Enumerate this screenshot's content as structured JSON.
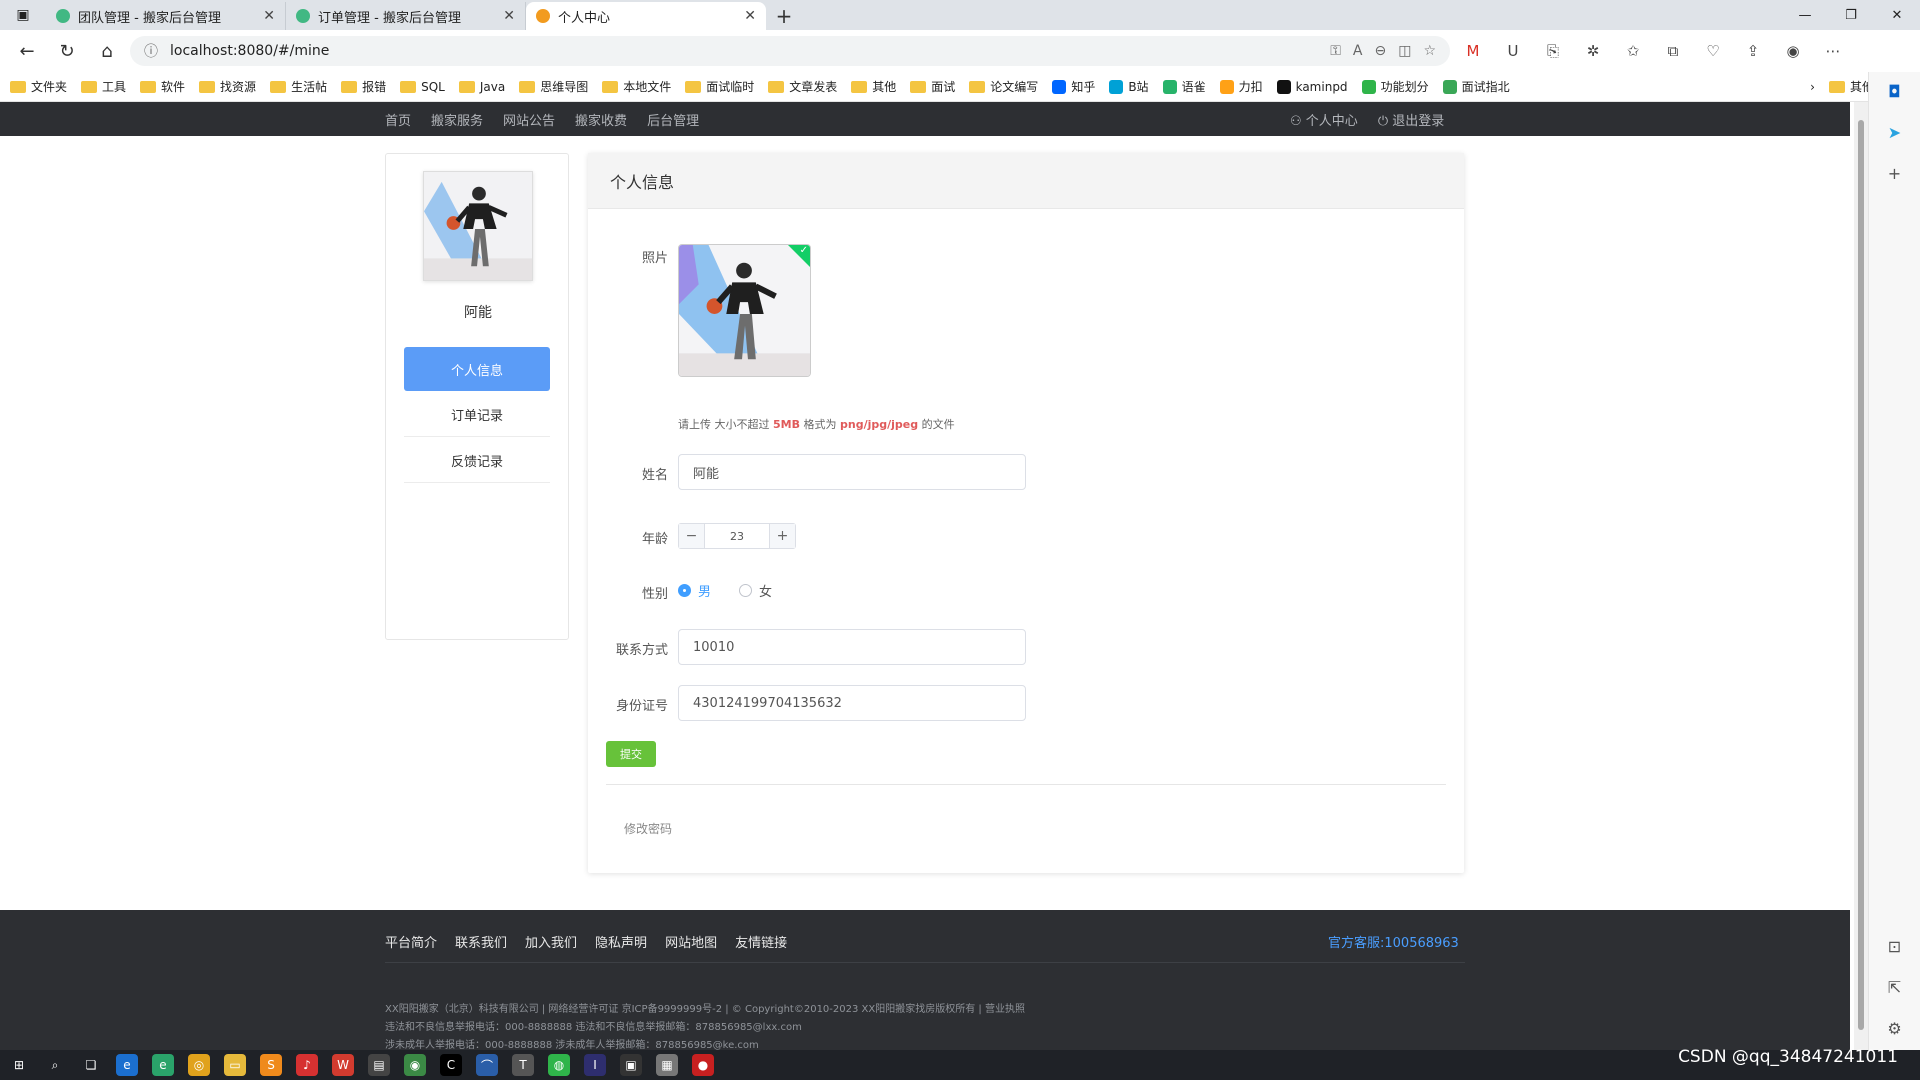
{
  "browser": {
    "tabs": [
      {
        "title": "团队管理 - 搬家后台管理",
        "favicon_color": "#41b883",
        "active": false
      },
      {
        "title": "订单管理 - 搬家后台管理",
        "favicon_color": "#41b883",
        "active": false
      },
      {
        "title": "个人中心",
        "favicon_color": "#f29b1f",
        "active": true
      }
    ],
    "url": "localhost:8080/#/mine",
    "bookmarks": [
      "文件夹",
      "工具",
      "软件",
      "找资源",
      "生活帖",
      "报错",
      "SQL",
      "Java",
      "思维导图",
      "本地文件",
      "面试临时",
      "文章发表",
      "其他",
      "面试",
      "论文编写",
      "知乎",
      "B站",
      "语雀",
      "力扣",
      "kaminpd",
      "功能划分",
      "面试指北"
    ],
    "bookmarks_more": "其他收藏夹"
  },
  "nav": {
    "links": [
      "首页",
      "搬家服务",
      "网站公告",
      "搬家收费",
      "后台管理"
    ],
    "user_center": "个人中心",
    "logout": "退出登录"
  },
  "sidebar": {
    "username": "阿能",
    "menu": [
      {
        "label": "个人信息",
        "active": true
      },
      {
        "label": "订单记录",
        "active": false
      },
      {
        "label": "反馈记录",
        "active": false
      }
    ]
  },
  "profile": {
    "title": "个人信息",
    "photo_label": "照片",
    "upload_tip_prefix": "请上传 大小不超过",
    "upload_tip_size": "5MB",
    "upload_tip_mid": "格式为",
    "upload_tip_format": "png/jpg/jpeg",
    "upload_tip_suffix": "的文件",
    "name_label": "姓名",
    "name_value": "阿能",
    "age_label": "年龄",
    "age_value": "23",
    "gender_label": "性别",
    "gender_male": "男",
    "gender_female": "女",
    "gender_selected": "男",
    "contact_label": "联系方式",
    "contact_value": "10010",
    "idcard_label": "身份证号",
    "idcard_value": "430124199704135632",
    "submit_label": "提交",
    "change_password": "修改密码"
  },
  "footer": {
    "links": [
      "平台简介",
      "联系我们",
      "加入我们",
      "隐私声明",
      "网站地图",
      "友情链接"
    ],
    "service": "官方客服:100568963",
    "lines": [
      "XX阳阳搬家（北京）科技有限公司 | 网络经营许可证 京ICP备9999999号-2 | © Copyright©2010-2023 XX阳阳搬家找房版权所有 | 营业执照",
      "违法和不良信息举报电话：000-8888888 违法和不良信息举报邮箱：878856985@lxx.com",
      "涉未成年人举报电话：000-8888888 涉未成年人举报邮箱：878856985@ke.com"
    ]
  },
  "watermark": "CSDN @qq_34847241011",
  "colors": {
    "primary_blue": "#5b9cf7",
    "success_green": "#67c23a",
    "dark_nav": "#2d2f33",
    "highlight_red": "#e05a5a"
  }
}
